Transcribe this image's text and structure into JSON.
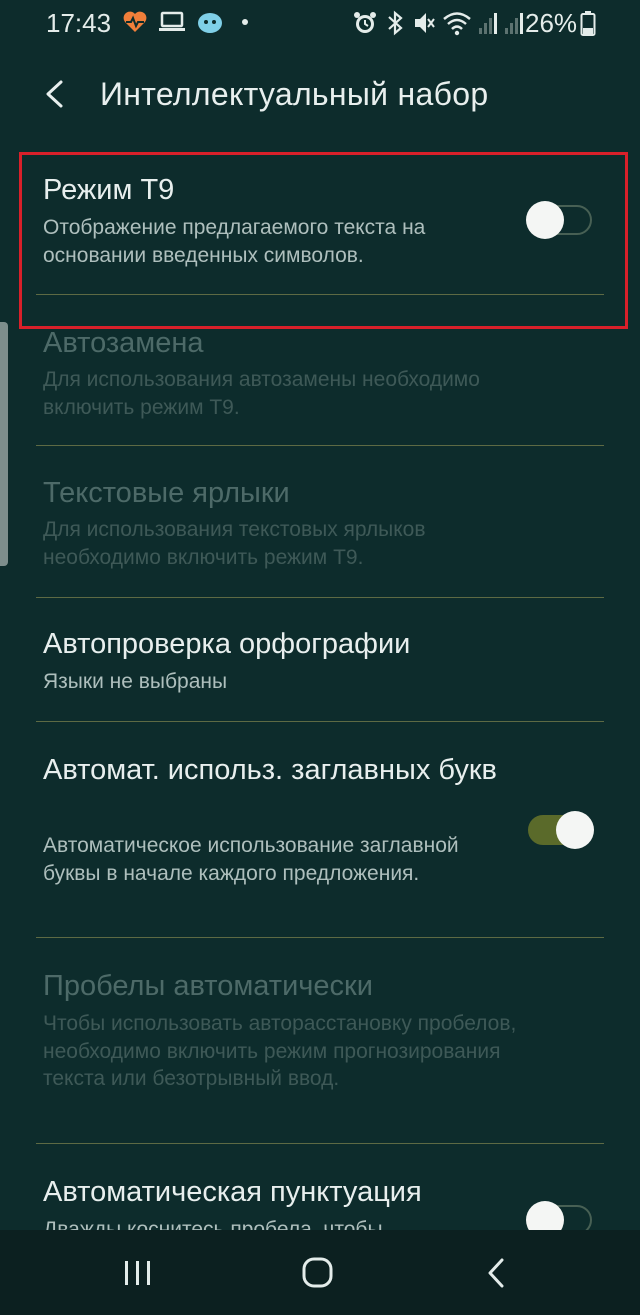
{
  "status_bar": {
    "time": "17:43",
    "battery": "26%",
    "left_icons": [
      "heart-pulse-icon",
      "laptop-icon",
      "app-bubble-icon",
      "more-dots-icon"
    ],
    "right_icons": [
      "alarm-icon",
      "bluetooth-icon",
      "vibrate-mute-icon",
      "wifi-icon",
      "signal-icon",
      "signal-icon",
      "battery-icon"
    ]
  },
  "header": {
    "title": "Интеллектуальный набор"
  },
  "settings": [
    {
      "title": "Режим T9",
      "subtitle": "Отображение предлагаемого текста на основании введенных символов.",
      "toggle": "off",
      "enabled": true
    },
    {
      "title": "Автозамена",
      "subtitle": "Для использования автозамены необходимо включить режим T9.",
      "enabled": false
    },
    {
      "title": "Текстовые ярлыки",
      "subtitle": "Для использования текстовых ярлыков необходимо включить режим T9.",
      "enabled": false
    },
    {
      "title": "Автопроверка орфографии",
      "subtitle": "Языки не выбраны",
      "enabled": true
    },
    {
      "title": "Автомат. использ. заглавных букв",
      "subtitle": "Автоматическое использование заглавной буквы в начале каждого предложения.",
      "toggle": "on",
      "enabled": true
    },
    {
      "title": "Пробелы автоматически",
      "subtitle": "Чтобы использовать авторасстановку пробелов, необходимо включить режим прогнозирования текста или безотрывный ввод.",
      "enabled": false
    },
    {
      "title": "Автоматическая пунктуация",
      "subtitle": "Дважды коснитесь пробела, чтобы",
      "toggle": "off",
      "enabled": true
    }
  ],
  "colors": {
    "background": "#0d2c2c",
    "highlight": "#d8202a",
    "divider": "#5d6a44",
    "toggle_on": "#5a6a2a"
  },
  "nav_bar": {
    "icons": [
      "recent-apps-icon",
      "home-icon",
      "back-icon"
    ]
  }
}
